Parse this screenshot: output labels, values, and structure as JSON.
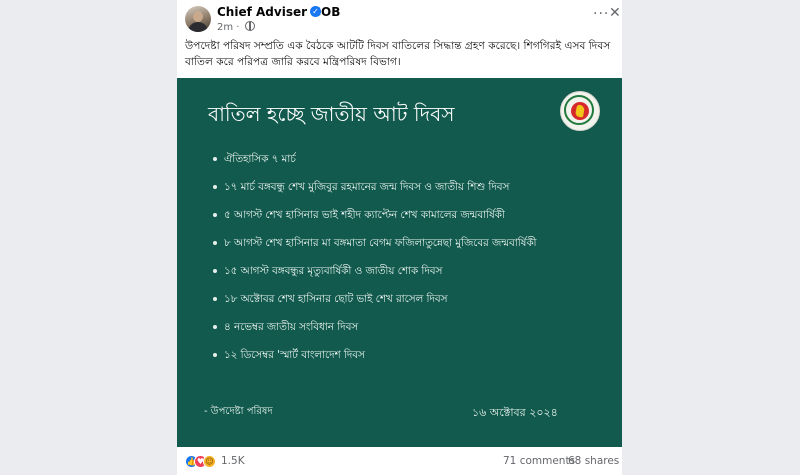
{
  "post": {
    "page_name": "Chief Adviser GOB",
    "time": "2m",
    "text": "উপদেষ্টা পরিষদ সম্প্রতি এক বৈঠকে আটটি দিবস বাতিলের সিদ্ধান্ত গ্রহণ করেছে। শিগগিরই এসব দিবস বাতিল করে পরিপত্র জারি করবে মন্ত্রিপরিষদ বিভাগ।"
  },
  "image": {
    "title": "বাতিল হচ্ছে জাতীয় আট দিবস",
    "items": [
      "ঐতিহাসিক ৭ মার্চ",
      "১৭ মার্চ বঙ্গবন্ধু শেখ মুজিবুর রহমানের জন্ম দিবস ও জাতীয় শিশু দিবস",
      "৫ আগস্ট শেখ হাসিনার ভাই শহীদ ক্যাপ্টেন শেখ কামালের জন্মবার্ষিকী",
      "৮ আগস্ট শেখ হাসিনার মা বঙ্গমাতা বেগম ফজিলাতুন্নেছা মুজিবের জন্মবার্ষিকী",
      "১৫ আগস্ট বঙ্গবন্ধুর মৃত্যুবার্ষিকী ও জাতীয় শোক দিবস",
      "১৮ অক্টোবর শেখ হাসিনার ছোট ভাই শেখ রাসেল দিবস",
      "৪ নভেম্বর জাতীয় সংবিধান দিবস",
      "১২ ডিসেম্বর 'স্মার্ট বাংলাদেশ দিবস"
    ],
    "signature": "- উপদেষ্টা পরিষদ",
    "date": "১৬ অক্টোবর ২০২৪"
  },
  "footer": {
    "reaction_count": "1.5K",
    "comments": "71 comments",
    "shares": "68 shares"
  },
  "icons": {
    "verified": "verified-badge-icon",
    "audience": "globe-icon",
    "more": "more-options-icon",
    "close": "close-icon",
    "reactions": [
      "like-icon",
      "love-icon",
      "care-icon"
    ]
  },
  "colors": {
    "panel_background": "#115a4d",
    "verified_blue": "#1877f2",
    "secondary_text": "#65676b"
  }
}
